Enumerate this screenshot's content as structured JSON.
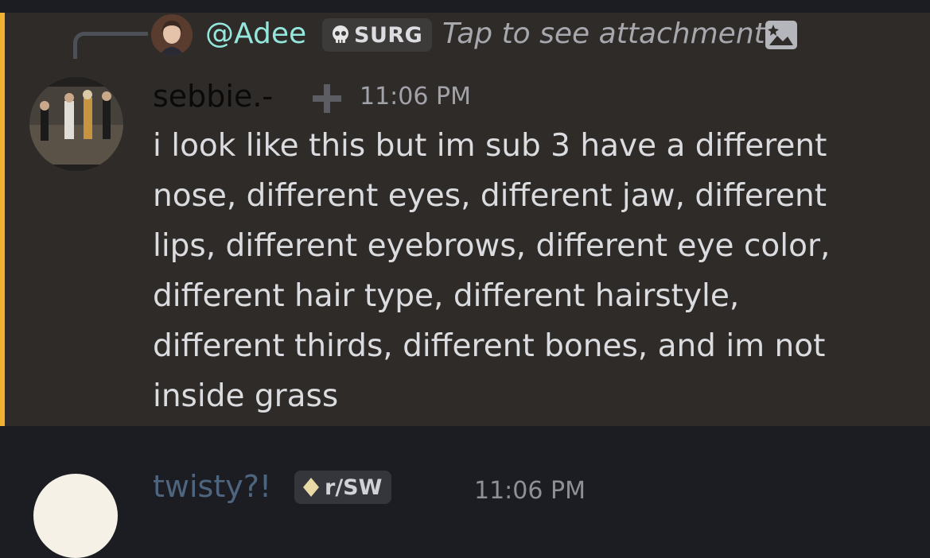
{
  "reply": {
    "username": "@Adee",
    "tag": "SURG",
    "tag_icon": "skull-icon",
    "preview_text": "Tap to see attachment",
    "attachment_icon": "image-icon"
  },
  "message": {
    "author": "sebbie.-",
    "timestamp": "11:06 PM",
    "body": "i look like this but im sub 3 have a different nose, different eyes, different jaw, different lips, different eyebrows, different eye color, different hair type, different hairstyle, different thirds, different bones, and im not inside grass"
  },
  "next_message": {
    "author": "twisty?!",
    "tag": "r/SW",
    "timestamp": "11:06 PM"
  },
  "colors": {
    "background": "#1c1d22",
    "mention_highlight": "#2e2b28",
    "mention_bar": "#f0b132",
    "reply_name": "#95e6dc",
    "body_text": "#dbdcdf"
  }
}
